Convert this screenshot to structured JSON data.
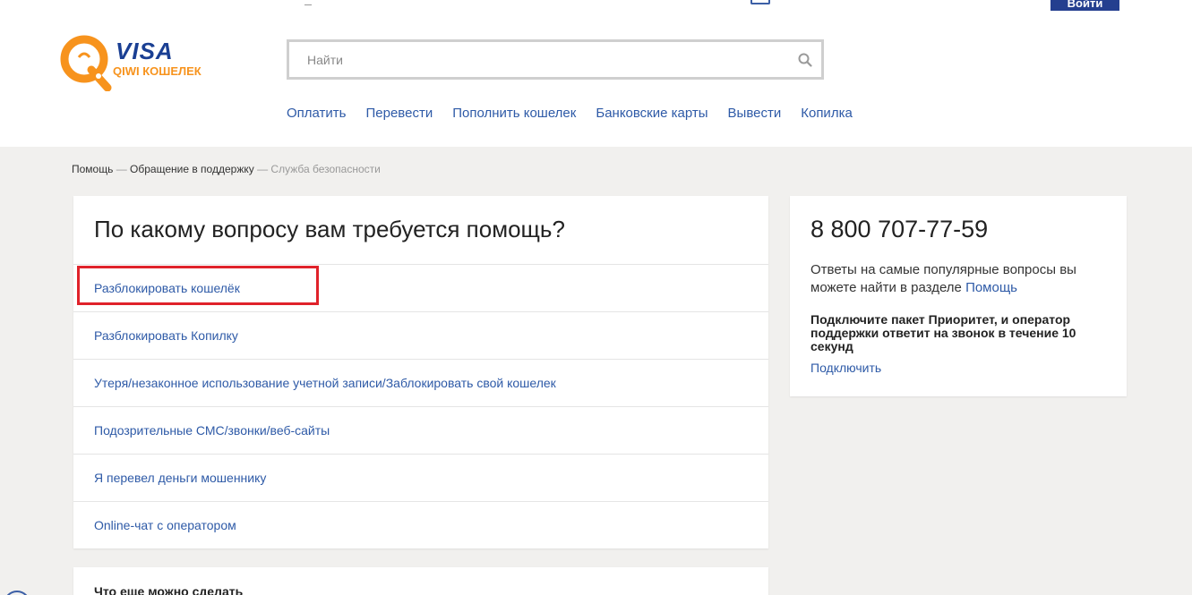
{
  "header": {
    "login_label": "Войти",
    "logo": {
      "visa_text": "VISA",
      "wallet_text": "QIWI КОШЕЛЕК"
    },
    "search": {
      "placeholder": "Найти",
      "value": ""
    },
    "nav": [
      {
        "label": "Оплатить"
      },
      {
        "label": "Перевести"
      },
      {
        "label": "Пополнить кошелек"
      },
      {
        "label": "Банковские карты"
      },
      {
        "label": "Вывести"
      },
      {
        "label": "Копилка"
      }
    ]
  },
  "breadcrumb": {
    "items": [
      "Помощь",
      "Обращение в поддержку"
    ],
    "separator": "—",
    "current": "Служба безопасности"
  },
  "main": {
    "title": "По какому вопросу вам требуется помощь?",
    "options": [
      {
        "label": "Разблокировать кошелёк"
      },
      {
        "label": "Разблокировать Копилку"
      },
      {
        "label": "Утеря/незаконное использование учетной записи/Заблокировать свой кошелек"
      },
      {
        "label": "Подозрительные СМС/звонки/веб-сайты"
      },
      {
        "label": "Я перевел деньги мошеннику"
      },
      {
        "label": "Online-чат с оператором"
      }
    ]
  },
  "side": {
    "phone": "8 800 707-77-59",
    "faq_text": "Ответы на самые популярные вопросы вы можете найти в разделе",
    "faq_link": "Помощь",
    "priority_text": "Подключите пакет Приоритет, и оператор поддержки ответит на звонок в течение 10 секунд",
    "connect_label": "Подключить"
  },
  "more": {
    "title": "Что еще можно сделать"
  },
  "colors": {
    "link": "#2e5aa7",
    "brand_blue": "#1a3f93",
    "brand_orange": "#f7931d",
    "highlight": "#e0222a",
    "background": "#f1f0ee"
  }
}
